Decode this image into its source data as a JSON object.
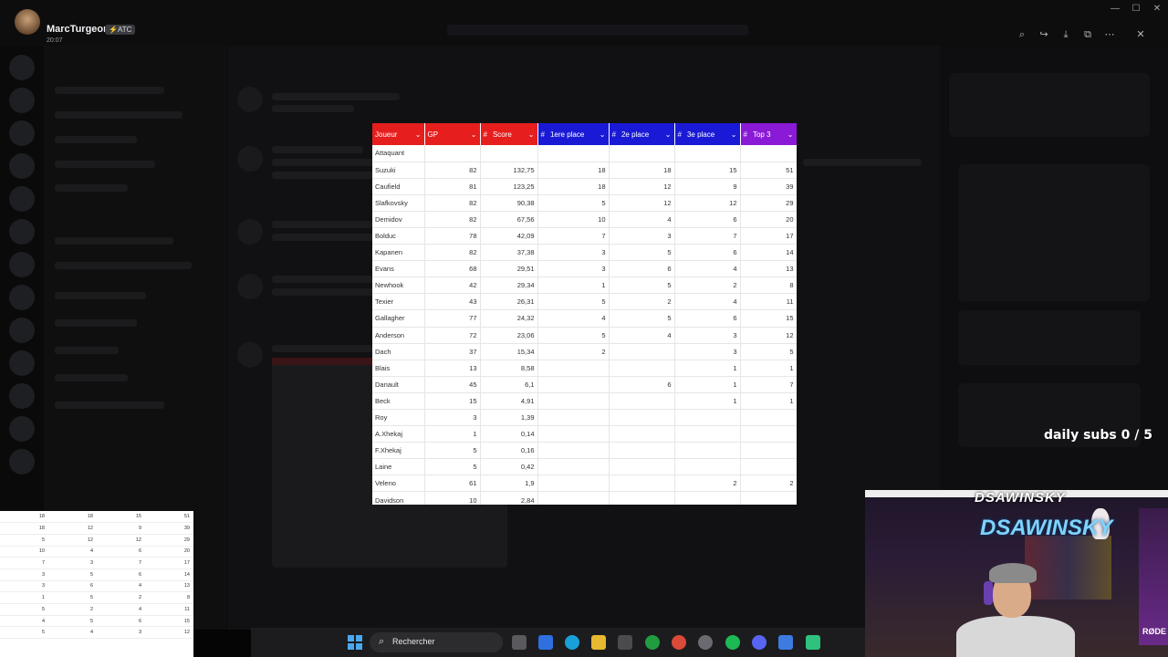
{
  "author": {
    "name": "MarcTurgeon",
    "badge": "⚡ATC",
    "time": "20:07"
  },
  "toolbar_icons": [
    "zoom-icon",
    "forward-icon",
    "download-icon",
    "open-external-icon",
    "more-icon",
    "close-icon"
  ],
  "sheet": {
    "columns": [
      {
        "label": "Joueur",
        "hash": "",
        "color": "#e61e1e"
      },
      {
        "label": "GP",
        "hash": "",
        "color": "#e61e1e"
      },
      {
        "label": "Score",
        "hash": "#",
        "color": "#e61e1e"
      },
      {
        "label": "1ere place",
        "hash": "#",
        "color": "#1a1ad6"
      },
      {
        "label": "2e place",
        "hash": "#",
        "color": "#1a1ad6"
      },
      {
        "label": "3e place",
        "hash": "#",
        "color": "#1a1ad6"
      },
      {
        "label": "Top 3",
        "hash": "#",
        "color": "#8a1ad6"
      }
    ],
    "section": "Attaquant",
    "rows": [
      [
        "Suzuki",
        "82",
        "132,75",
        "18",
        "18",
        "15",
        "51"
      ],
      [
        "Caufield",
        "81",
        "123,25",
        "18",
        "12",
        "9",
        "39"
      ],
      [
        "Slafkovsky",
        "82",
        "90,38",
        "5",
        "12",
        "12",
        "29"
      ],
      [
        "Demidov",
        "82",
        "67,56",
        "10",
        "4",
        "6",
        "20"
      ],
      [
        "Bolduc",
        "78",
        "42,09",
        "7",
        "3",
        "7",
        "17"
      ],
      [
        "Kapanen",
        "82",
        "37,38",
        "3",
        "5",
        "6",
        "14"
      ],
      [
        "Evans",
        "68",
        "29,51",
        "3",
        "6",
        "4",
        "13"
      ],
      [
        "Newhook",
        "42",
        "29,34",
        "1",
        "5",
        "2",
        "8"
      ],
      [
        "Texier",
        "43",
        "26,31",
        "5",
        "2",
        "4",
        "11"
      ],
      [
        "Gallagher",
        "77",
        "24,32",
        "4",
        "5",
        "6",
        "15"
      ],
      [
        "Anderson",
        "72",
        "23,06",
        "5",
        "4",
        "3",
        "12"
      ],
      [
        "Dach",
        "37",
        "15,34",
        "2",
        "",
        "3",
        "5"
      ],
      [
        "Blais",
        "13",
        "8,58",
        "",
        "",
        "1",
        "1"
      ],
      [
        "Danault",
        "45",
        "6,1",
        "",
        "6",
        "1",
        "7"
      ],
      [
        "Beck",
        "15",
        "4,91",
        "",
        "",
        "1",
        "1"
      ],
      [
        "Roy",
        "3",
        "1,39",
        "",
        "",
        "",
        ""
      ],
      [
        "A.Xhekaj",
        "1",
        "0,14",
        "",
        "",
        "",
        ""
      ],
      [
        "F.Xhekaj",
        "5",
        "0,16",
        "",
        "",
        "",
        ""
      ],
      [
        "Laine",
        "5",
        "0,42",
        "",
        "",
        "",
        ""
      ],
      [
        "Veleno",
        "61",
        "1,9",
        "",
        "",
        "2",
        "2"
      ],
      [
        "Davidson",
        "10",
        "2,84",
        "",
        "",
        "",
        ""
      ]
    ]
  },
  "mini_rows": [
    [
      "18",
      "18",
      "15",
      "51"
    ],
    [
      "18",
      "12",
      "9",
      "39"
    ],
    [
      "5",
      "12",
      "12",
      "29"
    ],
    [
      "10",
      "4",
      "6",
      "20"
    ],
    [
      "7",
      "3",
      "7",
      "17"
    ],
    [
      "3",
      "5",
      "6",
      "14"
    ],
    [
      "3",
      "6",
      "4",
      "13"
    ],
    [
      "1",
      "5",
      "2",
      "8"
    ],
    [
      "5",
      "2",
      "4",
      "11"
    ],
    [
      "4",
      "5",
      "6",
      "15"
    ],
    [
      "5",
      "4",
      "3",
      "12"
    ]
  ],
  "overlay": {
    "daily_subs": "daily subs 0 / 5"
  },
  "webcam": {
    "brand": "DSAWINSKY",
    "mic": "RØDE"
  },
  "taskbar": {
    "search_placeholder": "Rechercher"
  }
}
